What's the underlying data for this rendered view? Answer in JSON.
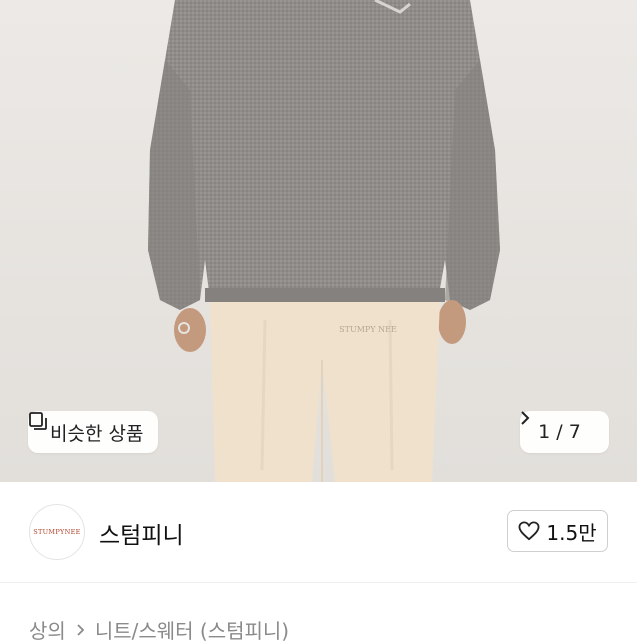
{
  "product_photo": {
    "similar_button_label": "비슷한 상품",
    "image_counter": "1 / 7",
    "brand_print": "STUMPY NEE"
  },
  "shop": {
    "logo_text": "STUMPYNEE",
    "name": "스텀피니",
    "like_count": "1.5만"
  },
  "breadcrumb": {
    "level1": "상의",
    "level2": "니트/스웨터 (스텀피니)"
  },
  "colors": {
    "sweater": "#8f8b88",
    "pants": "#efe1cc",
    "background": "#e8e5e2",
    "logo_accent": "#b0432b"
  }
}
